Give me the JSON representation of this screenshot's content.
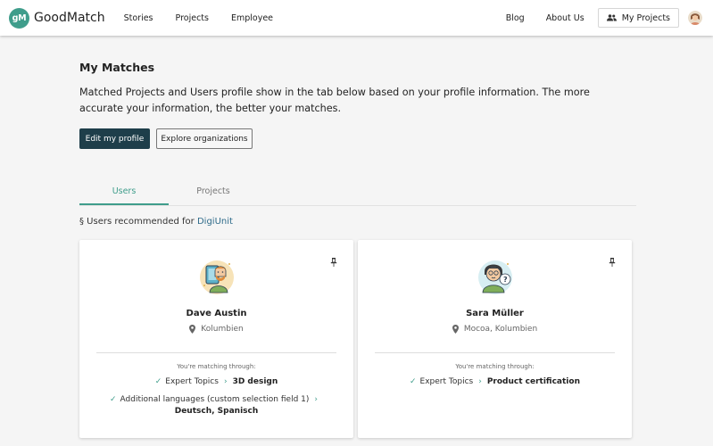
{
  "header": {
    "logo_mark": "gM",
    "logo_text": "GoodMatch",
    "nav": [
      {
        "label": "Stories"
      },
      {
        "label": "Projects"
      },
      {
        "label": "Employee"
      }
    ],
    "blog": "Blog",
    "about": "About Us",
    "my_projects": "My Projects"
  },
  "main": {
    "title": "My Matches",
    "description": "Matched Projects and Users profile show in the tab below based on your profile information. The more accurate your information, the better your matches.",
    "edit_profile": "Edit my profile",
    "explore": "Explore organizations",
    "tabs": [
      {
        "label": "Users",
        "active": true
      },
      {
        "label": "Projects",
        "active": false
      }
    ],
    "recommended_prefix": "§ Users recommended for",
    "recommended_org": "DigiUnit"
  },
  "cards": [
    {
      "name": "Dave Austin",
      "location": "Kolumbien",
      "matching_label": "You're matching through:",
      "rows": [
        {
          "label": "Expert Topics",
          "value": "3D design"
        },
        {
          "label": "Additional languages (custom selection  field 1)",
          "value": "Deutsch, Spanisch"
        }
      ]
    },
    {
      "name": "Sara Müller",
      "location": "Mocoa, Kolumbien",
      "matching_label": "You're matching through:",
      "rows": [
        {
          "label": "Expert Topics",
          "value": "Product certification"
        }
      ]
    }
  ],
  "colors": {
    "accent": "#3f9d8b",
    "primary_button": "#1e3e4a",
    "link": "#2e6b8a"
  }
}
